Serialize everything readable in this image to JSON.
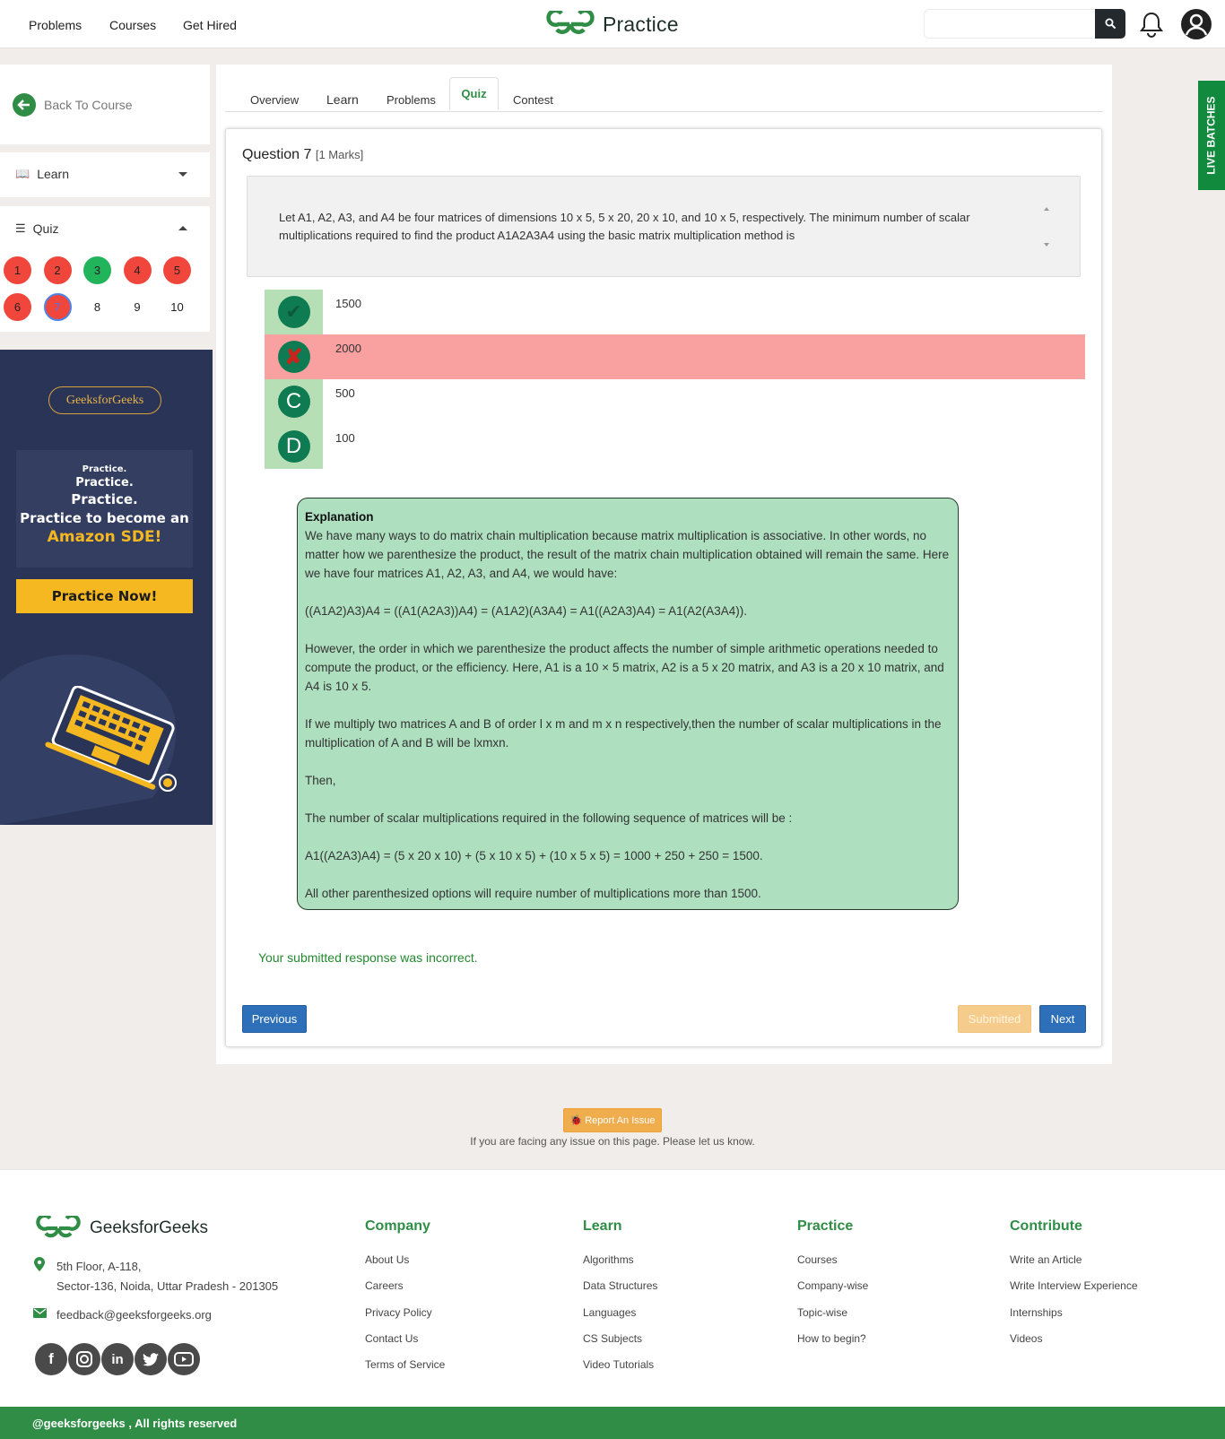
{
  "header": {
    "nav": [
      "Problems",
      "Courses",
      "Get Hired"
    ],
    "logo_text": "Practice",
    "search_placeholder": ""
  },
  "sidebar": {
    "back_label": "Back To Course",
    "learn_label": "Learn",
    "quiz_label": "Quiz",
    "questions": [
      {
        "n": "1",
        "status": "wrong"
      },
      {
        "n": "2",
        "status": "wrong"
      },
      {
        "n": "3",
        "status": "correct"
      },
      {
        "n": "4",
        "status": "wrong"
      },
      {
        "n": "5",
        "status": "wrong"
      },
      {
        "n": "6",
        "status": "wrong"
      },
      {
        "n": "7",
        "status": "current"
      },
      {
        "n": "8",
        "status": "unanswered"
      },
      {
        "n": "9",
        "status": "unanswered"
      },
      {
        "n": "10",
        "status": "unanswered"
      }
    ]
  },
  "ad": {
    "brand": "GeeksforGeeks",
    "line1": "Practice.",
    "line2": "Practice.",
    "line3": "Practice.",
    "line4": "Practice to become an",
    "line5": "Amazon SDE!",
    "cta": "Practice Now!"
  },
  "tabs": [
    "Overview",
    "Learn",
    "Problems",
    "Quiz",
    "Contest"
  ],
  "question": {
    "title": "Question 7",
    "marks": "[1 Marks]",
    "text": "Let A1, A2, A3, and A4 be four matrices of dimensions 10 x 5, 5 x 20, 20 x 10, and 10 x 5, respectively. The minimum number of scalar multiplications required to find the product A1A2A3A4 using the basic matrix multiplication method is",
    "options": [
      {
        "mark": "✔",
        "text": "1500",
        "state": "correct"
      },
      {
        "mark": "✘",
        "text": "2000",
        "state": "selected-wrong"
      },
      {
        "mark": "C",
        "text": "500",
        "state": "normal"
      },
      {
        "mark": "D",
        "text": "100",
        "state": "normal"
      }
    ]
  },
  "explanation": {
    "title": "Explanation",
    "paragraphs": [
      "We have many ways to do matrix chain multiplication because matrix multiplication is associative. In other words, no matter how we parenthesize the product, the result of the matrix chain multiplication obtained will remain the same. Here we have four matrices A1, A2, A3, and A4, we would have:",
      "((A1A2)A3)A4 = ((A1(A2A3))A4) = (A1A2)(A3A4) = A1((A2A3)A4) = A1(A2(A3A4)).",
      "However, the order in which we parenthesize the product affects the number of simple arithmetic operations needed to compute the product, or the efficiency. Here, A1 is a 10 × 5 matrix, A2 is a 5 x 20 matrix, and A3 is a 20 x 10 matrix, and A4 is 10 x 5.",
      "If we multiply two matrices A and B of order l x m and m x n respectively,then the number of scalar multiplications in the multiplication of A and B will be lxmxn.",
      "Then,",
      "The number of scalar multiplications required in the following sequence of matrices will be :",
      "A1((A2A3)A4) = (5 x 20 x 10) + (5 x 10 x 5) + (10 x 5 x 5) = 1000 + 250 + 250 = 1500.",
      "All other parenthesized options will require number of multiplications more than 1500."
    ]
  },
  "result_text": "Your submitted response was incorrect.",
  "buttons": {
    "previous": "Previous",
    "submitted": "Submitted",
    "next": "Next"
  },
  "report": {
    "button": "🐞 Report An Issue",
    "note": "If you are facing any issue on this page. Please let us know."
  },
  "live_batches": "LIVE BATCHES",
  "footer": {
    "logo_text": "GeeksforGeeks",
    "address_line1": "5th Floor, A-118,",
    "address_line2": "Sector-136, Noida, Uttar Pradesh - 201305",
    "email": "feedback@geeksforgeeks.org",
    "columns": [
      {
        "title": "Company",
        "links": [
          "About Us",
          "Careers",
          "Privacy Policy",
          "Contact Us",
          "Terms of Service"
        ]
      },
      {
        "title": "Learn",
        "links": [
          "Algorithms",
          "Data Structures",
          "Languages",
          "CS Subjects",
          "Video Tutorials"
        ]
      },
      {
        "title": "Practice",
        "links": [
          "Courses",
          "Company-wise",
          "Topic-wise",
          "How to begin?"
        ]
      },
      {
        "title": "Contribute",
        "links": [
          "Write an Article",
          "Write Interview Experience",
          "Internships",
          "Videos"
        ]
      }
    ],
    "social": [
      "facebook-icon",
      "instagram-icon",
      "linkedin-icon",
      "twitter-icon",
      "youtube-icon"
    ],
    "copyright": "@geeksforgeeks , All rights reserved"
  },
  "colors": {
    "brand_green": "#2f8d46",
    "wrong": "#f0463c",
    "correct": "#22b45a",
    "selected_wrong_row": "#f9a0a0",
    "option_mark": "#0f7b52"
  }
}
